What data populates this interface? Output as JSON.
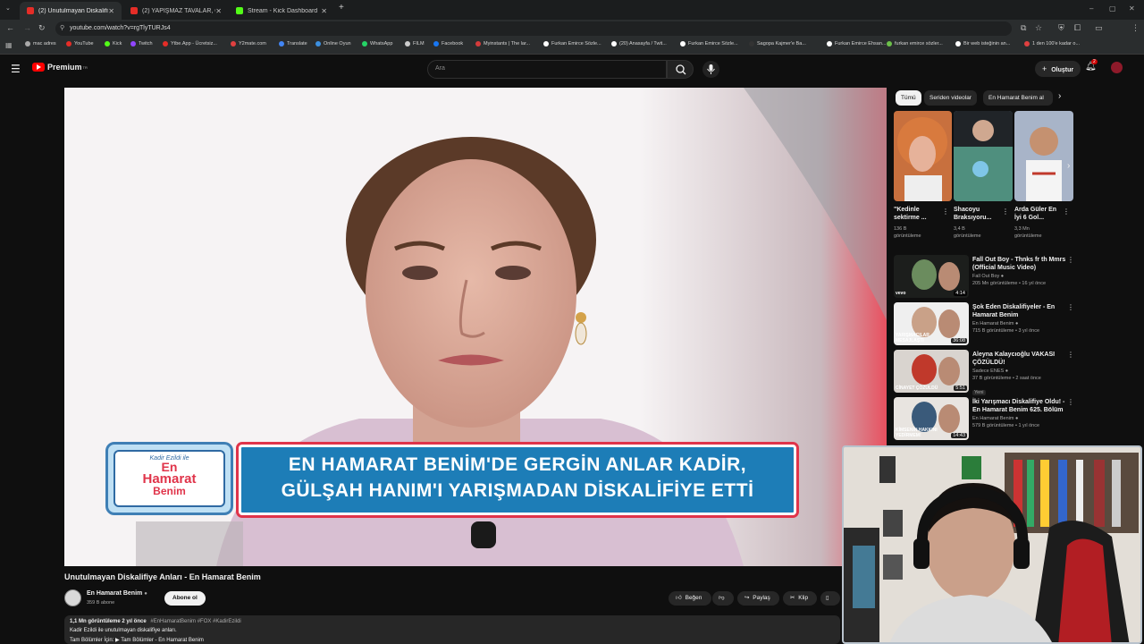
{
  "browser": {
    "tabs": [
      {
        "label": "(2) Unutulmayan Diskalifiye Anl...",
        "active": true,
        "favicon_color": "#e52d27"
      },
      {
        "label": "(2) YAPIŞMAZ TAVALAR, GERGİN...",
        "active": false,
        "favicon_color": "#e52d27"
      },
      {
        "label": "Stream - Kick Dashboard",
        "active": false,
        "favicon_color": "#53fc18"
      }
    ],
    "url": "youtube.com/watch?v=rgTlyTURJs4",
    "bookmarks": [
      {
        "label": "mac adres",
        "color": "#aaaaaa"
      },
      {
        "label": "YouTube",
        "color": "#e52d27"
      },
      {
        "label": "Kick",
        "color": "#53fc18"
      },
      {
        "label": "Twitch",
        "color": "#9146ff"
      },
      {
        "label": "Ytbe.App - Ücretsiz...",
        "color": "#e52d27"
      },
      {
        "label": "Y2mate.com",
        "color": "#e04040"
      },
      {
        "label": "Translate",
        "color": "#4285f4"
      },
      {
        "label": "Online Oyun",
        "color": "#3c8fe0"
      },
      {
        "label": "WhatsApp",
        "color": "#25d366"
      },
      {
        "label": "FILM",
        "color": "#cccccc"
      },
      {
        "label": "Facebook",
        "color": "#1877f2"
      },
      {
        "label": "Myinstants | The lar...",
        "color": "#d43b3b"
      },
      {
        "label": "Furkan Emirce Sözle...",
        "color": "#ffffff"
      },
      {
        "label": "(20) Anasayfa / Twit...",
        "color": "#ffffff"
      },
      {
        "label": "Furkan Emirce Sözle...",
        "color": "#ffffff"
      },
      {
        "label": "Sagopa Kajmer'e Ba...",
        "color": "#333333"
      },
      {
        "label": "Furkan Emirce Ehsan...",
        "color": "#ffffff"
      },
      {
        "label": "furkan emirce sözler...",
        "color": "#6cc04a"
      },
      {
        "label": "Bir web isteğinin an...",
        "color": "#ffffff"
      },
      {
        "label": "1 den 100'e kadar o...",
        "color": "#e04040"
      }
    ]
  },
  "youtube": {
    "logo_text": "Premium",
    "logo_sup": "TR",
    "search_placeholder": "Ara",
    "create_label": "Oluştur",
    "notif_count": "2",
    "brand_color": "#ff0000"
  },
  "video": {
    "banner_logo_lines": [
      "Kadir Ezildi ile",
      "En",
      "Hamarat",
      "Benim"
    ],
    "banner_line1": "EN HAMARAT BENİM'DE GERGİN ANLAR KADİR,",
    "banner_line2": "GÜLŞAH HANIM'I YARIŞMADAN DİSKALİFİYE ETTİ",
    "title": "Unutulmayan Diskalifiye Anları - En Hamarat Benim",
    "channel": "En Hamarat Benim",
    "subs": "359 B abone",
    "subscribe_label": "Abone ol",
    "like_label": "Beğen",
    "share_label": "Paylaş",
    "clip_label": "Klip",
    "views_line": "1,1 Mn görüntüleme  2 yıl önce",
    "hashtags": "#EnHamaratBenim #FOX #KadirEzildi",
    "desc_line1": "Kadir Ezildi ile unutulmayan diskalifiye anları.",
    "desc_line2": "Tam Bölümler İçin: ▶ Tam Bölümler - En Hamarat Benim"
  },
  "sidebar": {
    "chips": [
      "Tümü",
      "Seriden videolar",
      "En Hamarat Benim al"
    ],
    "shorts": [
      {
        "title": "\"Kedinle sektirme ...",
        "views": "136 B",
        "unit": "görüntüleme"
      },
      {
        "title": "Shacoyu Braksıyoru...",
        "views": "3,4 B",
        "unit": "görüntüleme"
      },
      {
        "title": "Arda Güler En İyi 6 Gol...",
        "views": "3,3 Mn",
        "unit": "görüntüleme"
      }
    ],
    "videos": [
      {
        "title1": "Fall Out Boy - Thnks fr th Mmrs",
        "title2": "(Official Music Video)",
        "channel": "Fall Out Boy",
        "meta": "205 Mn görüntüleme • 16 yıl önce",
        "duration": "4:14",
        "badge": "vevo"
      },
      {
        "title1": "Şok Eden Diskalifiyeler - En",
        "title2": "Hamarat Benim",
        "channel": "En Hamarat Benim",
        "meta": "715 B görüntüleme • 3 yıl önce",
        "duration": "36:08",
        "badge": "YARIŞMACILAR MESAJLAŞTI"
      },
      {
        "title1": "Aleyna Kalaycıoğlu VAKASI",
        "title2": "ÇÖZÜLDÜ!",
        "channel": "Sadece ENES",
        "meta": "37 B görüntüleme • 2 saat önce",
        "duration": "5:51",
        "badge": "CİNAYET ÇÖZÜLDÜ",
        "new_label": "Yeni"
      },
      {
        "title1": "İki Yarışmacı Diskalifiye Oldu! -",
        "title2": "En Hamarat Benim 625. Bölüm",
        "channel": "En Hamarat Benim",
        "meta": "579 B görüntüleme • 1 yıl önce",
        "duration": "14:43",
        "badge": "KİMSENİN HAKKINI YEDİRMEM!"
      }
    ]
  }
}
